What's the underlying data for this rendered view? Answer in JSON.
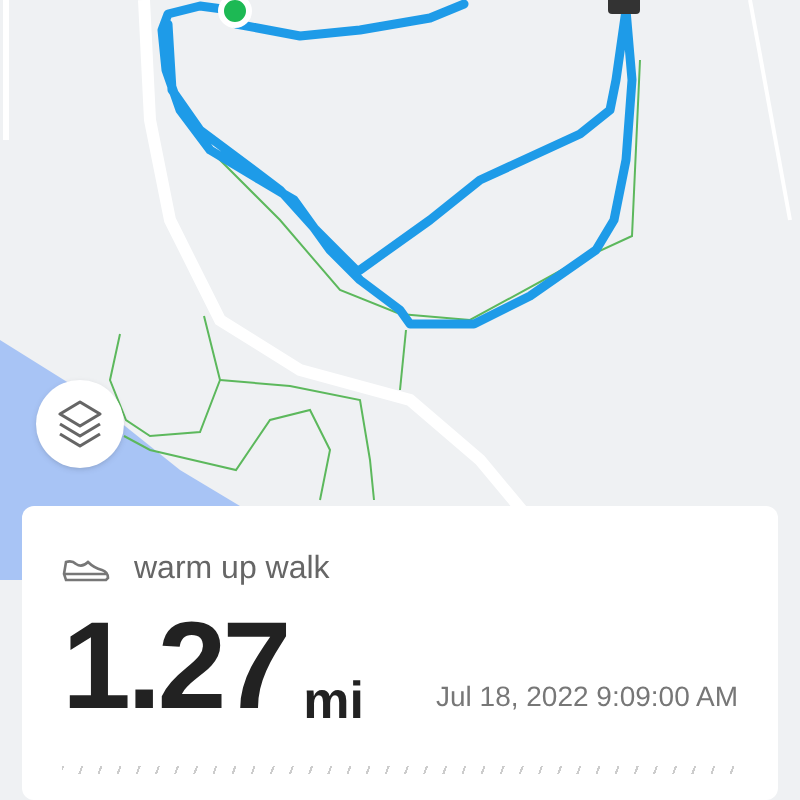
{
  "activity": {
    "name": "warm up walk",
    "distance": "1.27",
    "unit": "mi",
    "date": "Jul 18, 2022 9:09:00 AM"
  }
}
